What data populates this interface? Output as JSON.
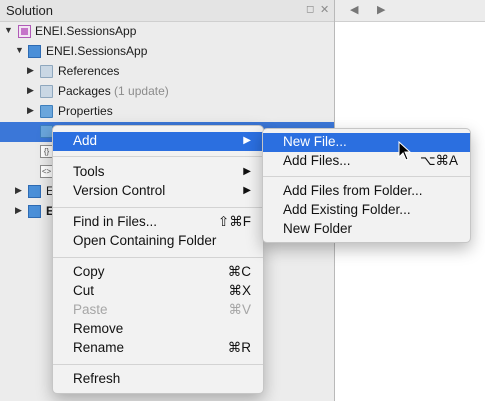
{
  "pad": {
    "title": "Solution",
    "float_icon": "float-icon",
    "close_icon": "close-icon"
  },
  "tree": {
    "solution": "ENEI.SessionsApp",
    "project": "ENEI.SessionsApp",
    "references": "References",
    "packages": "Packages",
    "packages_note": "(1 update)",
    "properties": "Properties",
    "project_b_prefix": "E",
    "project_c_prefix": "E"
  },
  "menu": {
    "add": "Add",
    "tools": "Tools",
    "version_control": "Version Control",
    "find_in_files": "Find in Files...",
    "find_in_files_shortcut": "⇧⌘F",
    "open_containing_folder": "Open Containing Folder",
    "copy": "Copy",
    "copy_shortcut": "⌘C",
    "cut": "Cut",
    "cut_shortcut": "⌘X",
    "paste": "Paste",
    "paste_shortcut": "⌘V",
    "remove": "Remove",
    "rename": "Rename",
    "rename_shortcut": "⌘R",
    "refresh": "Refresh"
  },
  "submenu": {
    "new_file": "New File...",
    "add_files": "Add Files...",
    "add_files_shortcut": "⌥⌘A",
    "add_files_from_folder": "Add Files from Folder...",
    "add_existing_folder": "Add Existing Folder...",
    "new_folder": "New Folder"
  },
  "icons": {
    "submenu_arrow": "▶",
    "expanded": "▼",
    "collapsed": "▶"
  },
  "colors": {
    "selection": "#3b77d8",
    "highlight": "#2b6fe0"
  }
}
